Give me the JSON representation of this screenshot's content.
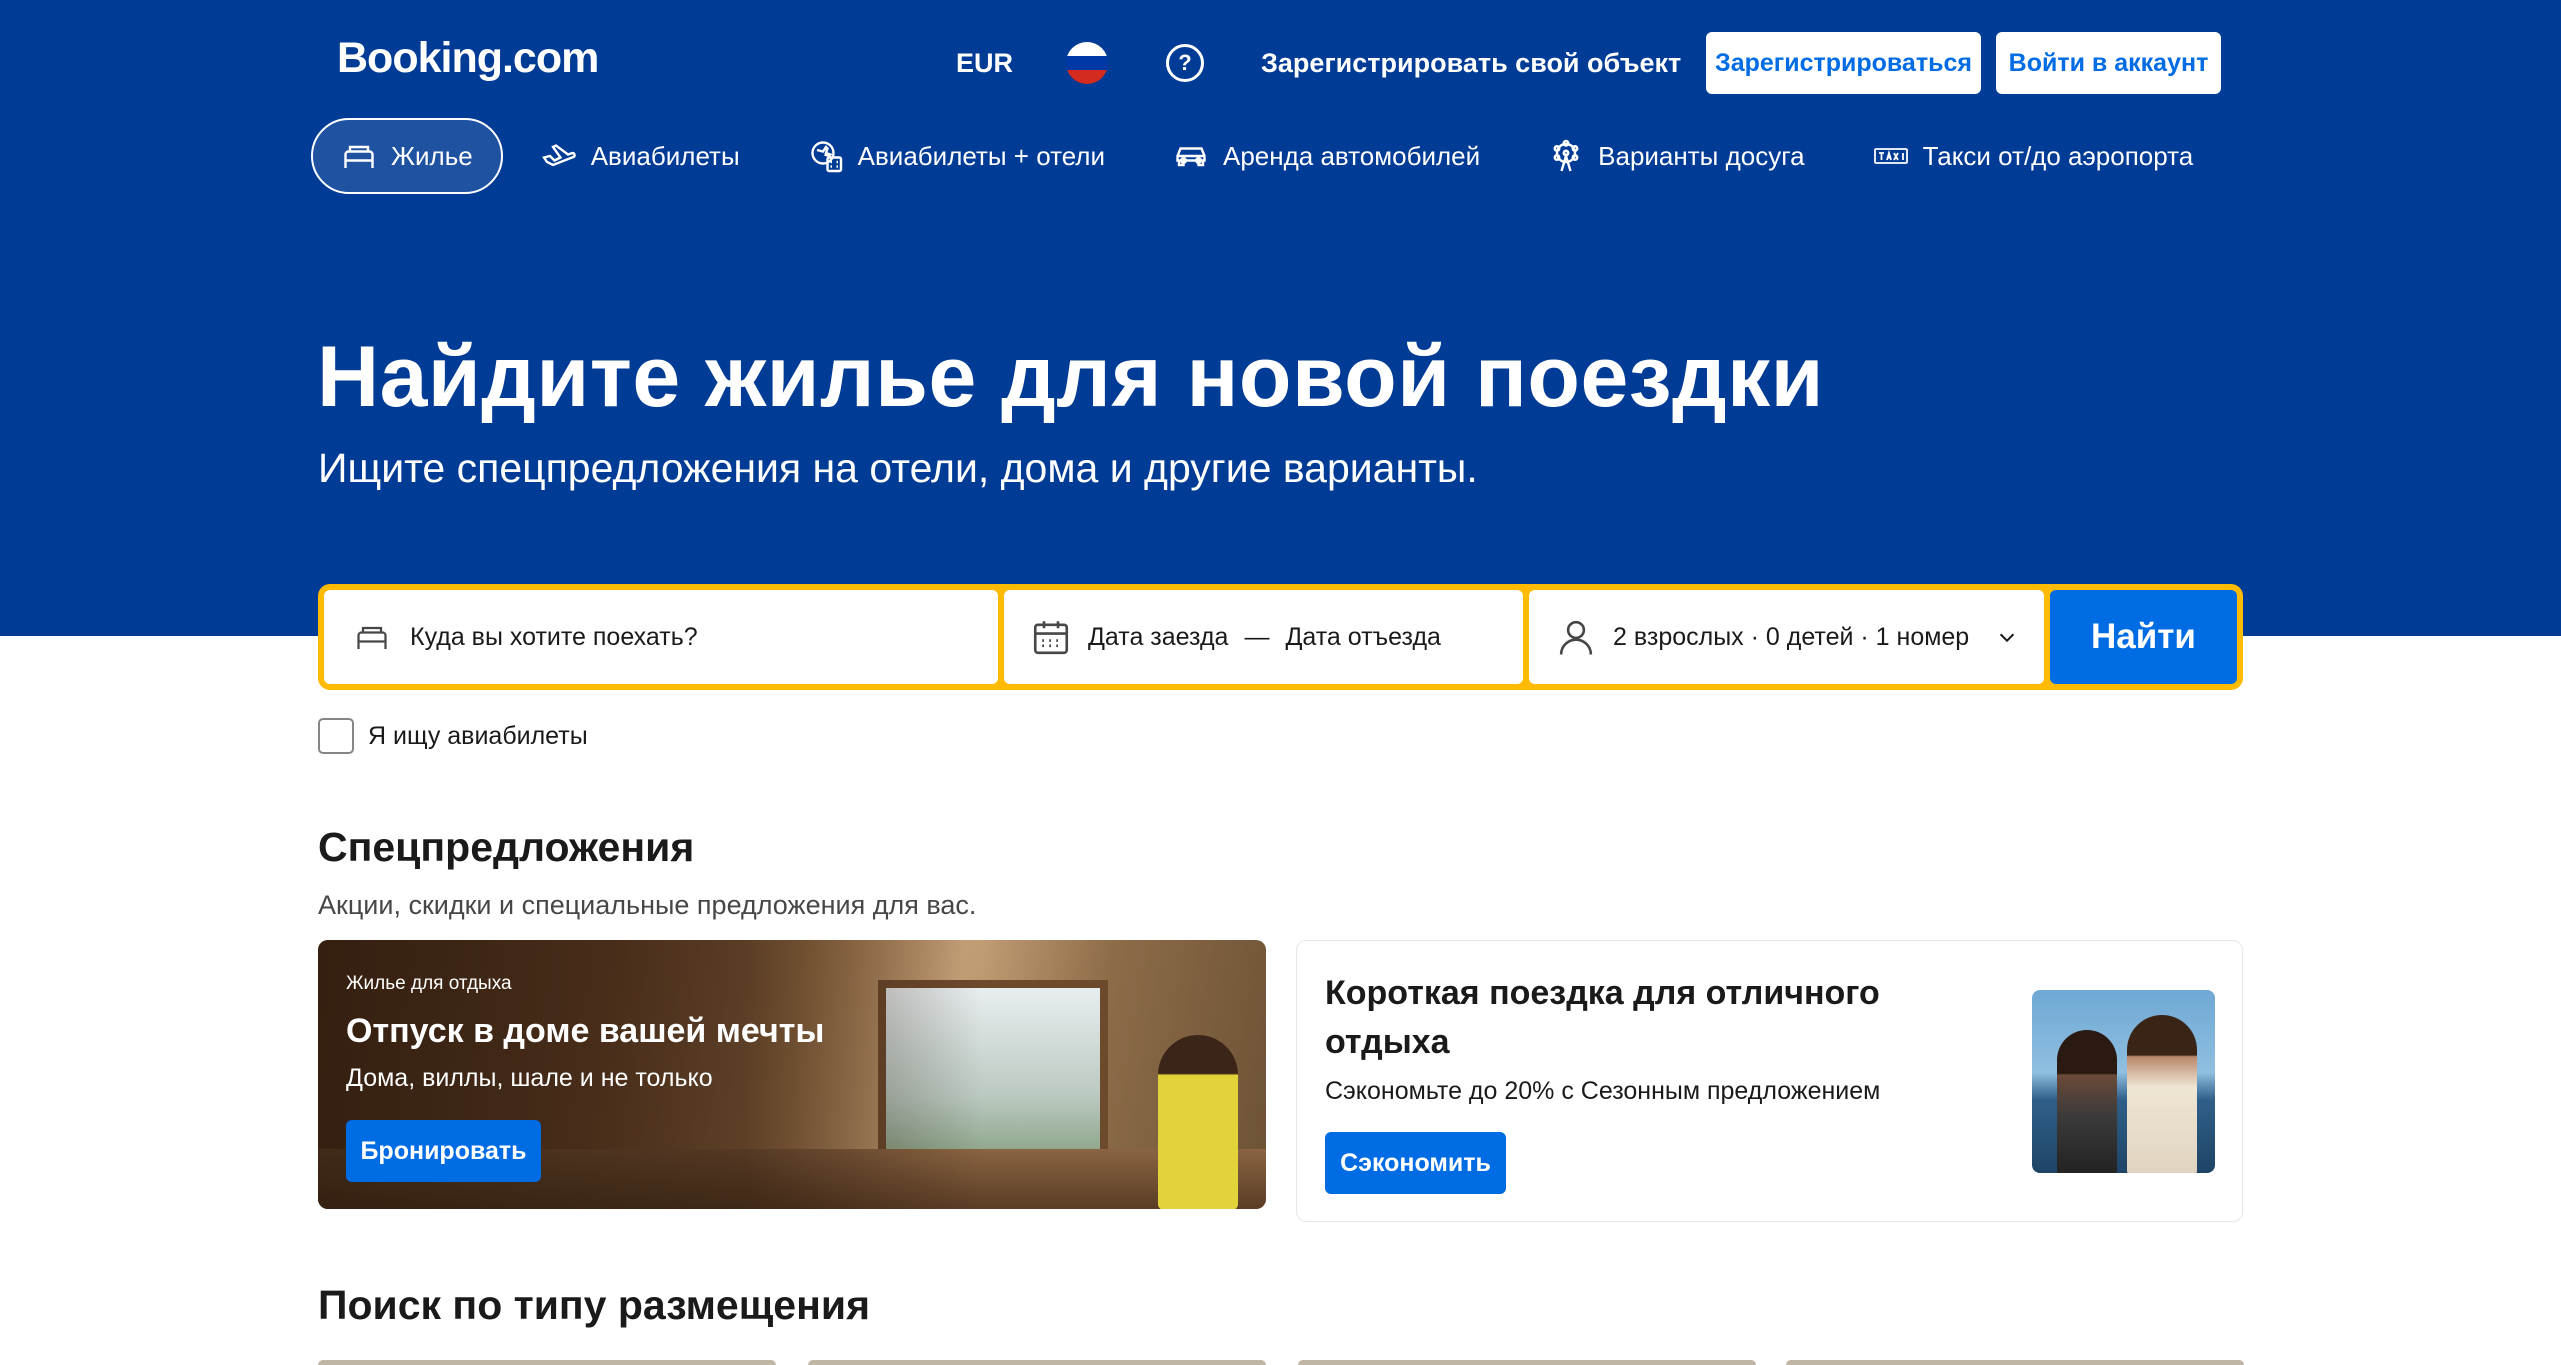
{
  "header": {
    "logo": "Booking.com",
    "currency": "EUR",
    "flag": "russian-flag",
    "help_icon": "?",
    "list_property": "Зарегистрировать свой объект",
    "register_button": "Зарегистрироваться",
    "signin_button": "Войти в аккаунт"
  },
  "nav": {
    "items": [
      {
        "label": "Жилье",
        "icon": "bed-icon",
        "active": true
      },
      {
        "label": "Авиабилеты",
        "icon": "plane-icon"
      },
      {
        "label": "Авиабилеты + отели",
        "icon": "plane-hotel-icon"
      },
      {
        "label": "Аренда автомобилей",
        "icon": "car-icon"
      },
      {
        "label": "Варианты досуга",
        "icon": "ferris-wheel-icon"
      },
      {
        "label": "Такси от/до аэропорта",
        "icon": "taxi-icon"
      }
    ]
  },
  "hero": {
    "title": "Найдите жилье для новой поездки",
    "subtitle": "Ищите спецпредложения на отели, дома и другие варианты."
  },
  "search": {
    "destination_placeholder": "Куда вы хотите поехать?",
    "checkin": "Дата заезда",
    "dash": "—",
    "checkout": "Дата отъезда",
    "guests": "2 взрослых · 0 детей · 1 номер",
    "submit": "Найти",
    "flights_checkbox": "Я ищу авиабилеты",
    "flights_checked": false
  },
  "offers": {
    "title": "Спецпредложения",
    "subtitle": "Акции, скидки и специальные предложения для вас.",
    "card1": {
      "eyebrow": "Жилье для отдыха",
      "title": "Отпуск в доме вашей мечты",
      "description": "Дома, виллы, шале и не только",
      "button": "Бронировать"
    },
    "card2": {
      "title": "Короткая поездка для отличного отдыха",
      "description": "Сэкономьте до 20% с Сезонным предложением",
      "button": "Сэкономить"
    }
  },
  "property_types": {
    "title": "Поиск по типу размещения"
  },
  "colors": {
    "brand_blue": "#003b95",
    "action_blue": "#006ce4",
    "search_border": "#febb02"
  }
}
